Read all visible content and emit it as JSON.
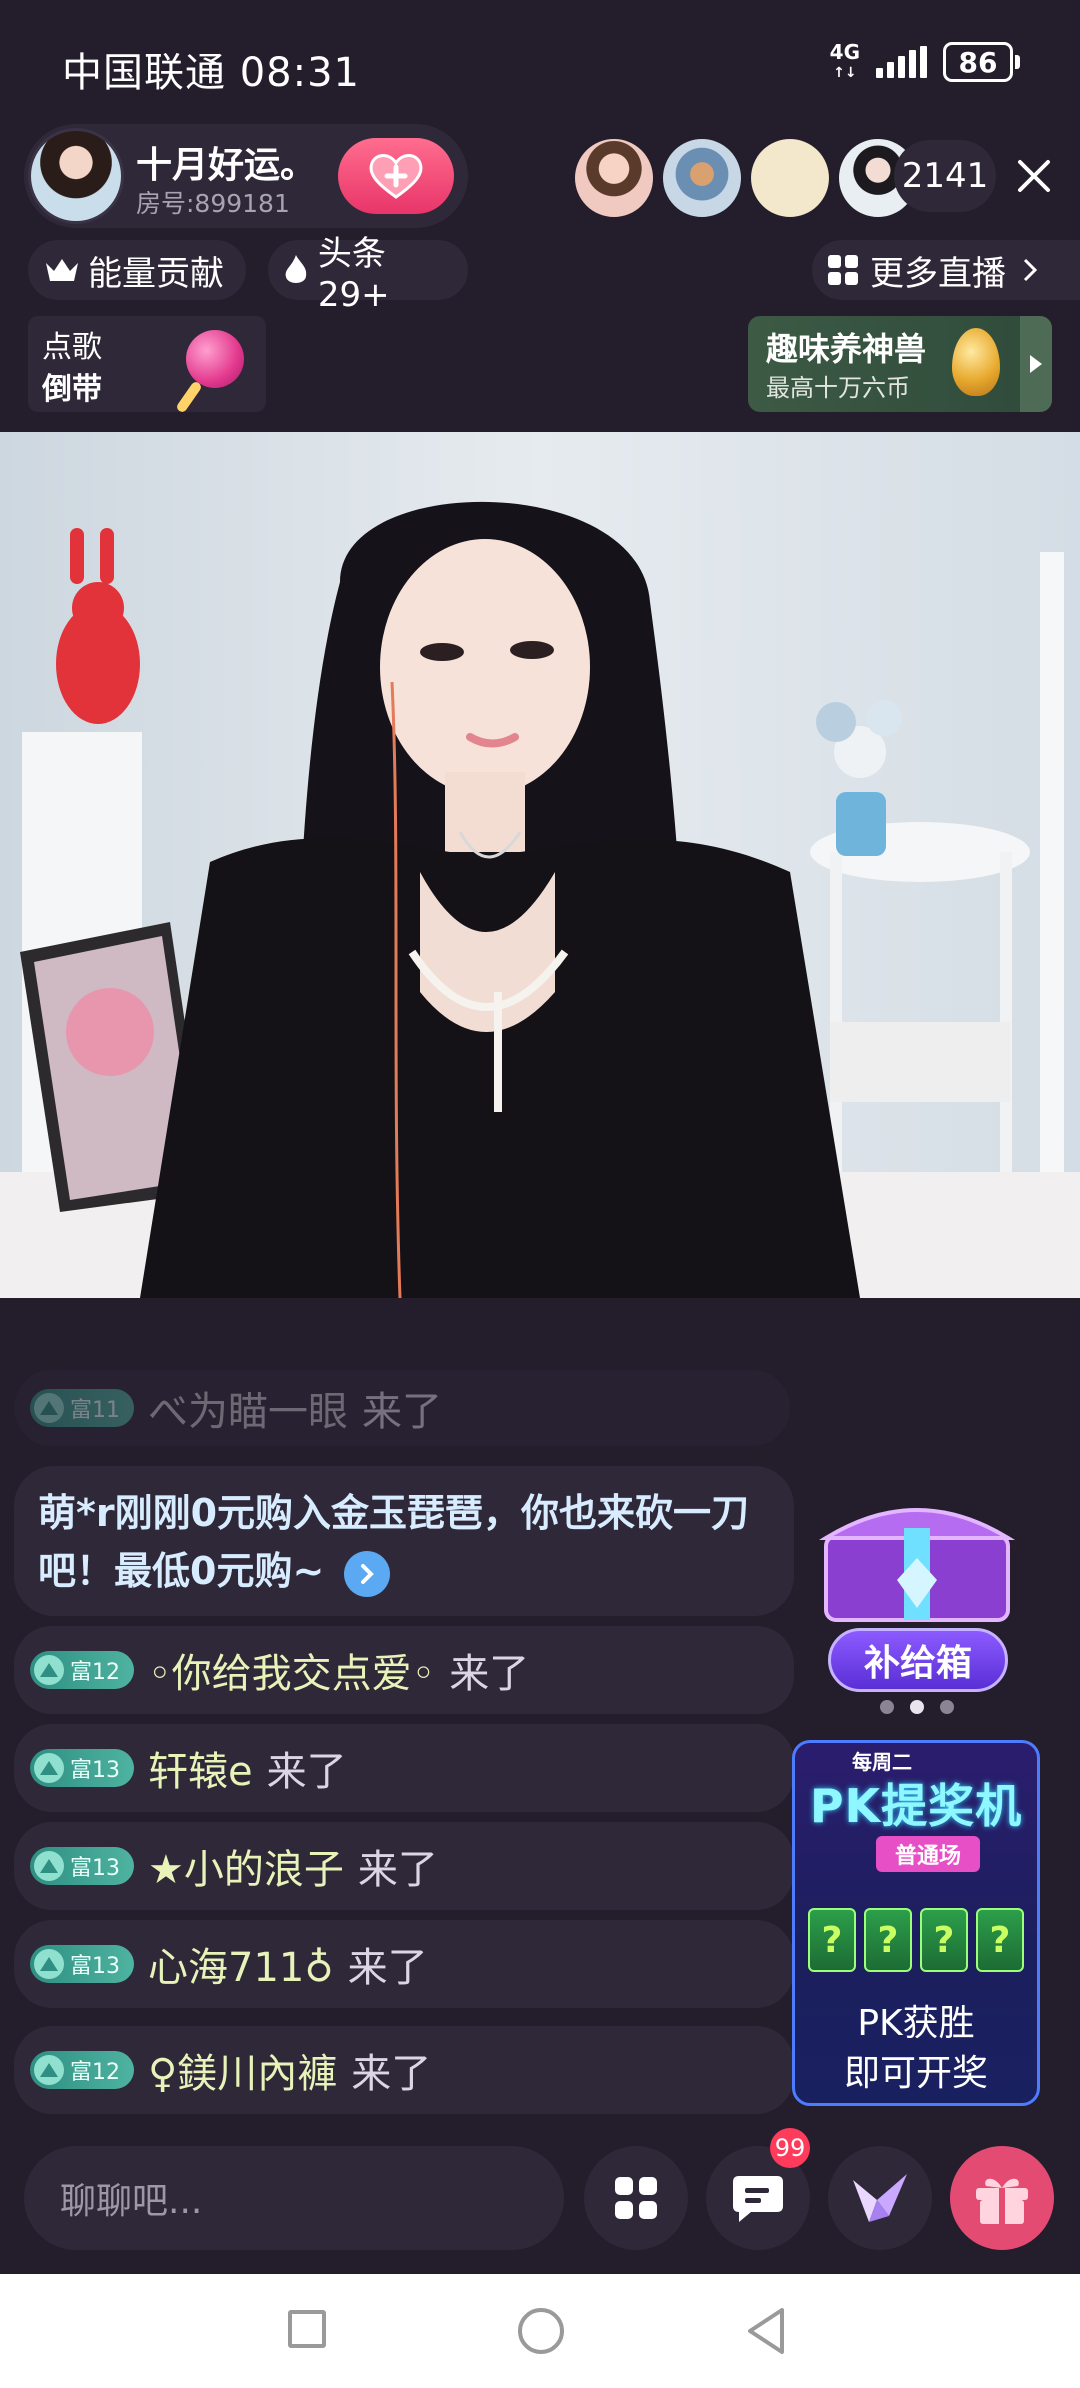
{
  "status_bar": {
    "carrier_time": "中国联通 08:31",
    "network": "4G",
    "battery": "86"
  },
  "host": {
    "name": "十月好运。",
    "room_no": "房号:899181"
  },
  "viewers": {
    "count": "2141"
  },
  "pills": {
    "energy": "能量贡献",
    "headline": "头条 29+",
    "more_live": "更多直播"
  },
  "song": {
    "line1": "点歌",
    "line2": "倒带"
  },
  "beast": {
    "title": "趣味养神兽",
    "subtitle": "最高十万六币"
  },
  "chat": {
    "top_partial": {
      "level": "富11",
      "user": "べ为瞄一眼",
      "action": "来了"
    },
    "promo": {
      "text": "萌*r刚刚0元购入金玉琵琶，你也来砍一刀吧！最低0元购~"
    },
    "messages": [
      {
        "level": "富12",
        "user": "◦你给我交点爱◦",
        "action": "来了"
      },
      {
        "level": "富13",
        "user": "轩辕e",
        "action": "来了"
      },
      {
        "level": "富13",
        "user": "★小的浪子",
        "action": "来了"
      },
      {
        "level": "富13",
        "user": "心海711♁",
        "action": "来了"
      },
      {
        "level": "富12",
        "user": "♀鎂川內褲",
        "action": "来了"
      }
    ]
  },
  "side": {
    "supply_label": "补给箱",
    "pk_weekly": "每周二",
    "pk_title": "PK提奖机",
    "pk_mode": "普通场",
    "pk_slot": "?",
    "pk_win": "PK获胜",
    "pk_open": "即可开奖"
  },
  "bottom": {
    "placeholder": "聊聊吧...",
    "msg_badge": "99"
  },
  "colors": {
    "background": "#231d2c",
    "pill_bg": "#2f2838",
    "level_badge": "#2e8f82",
    "username": "#e7f3b9",
    "gift": "#e44b73"
  }
}
